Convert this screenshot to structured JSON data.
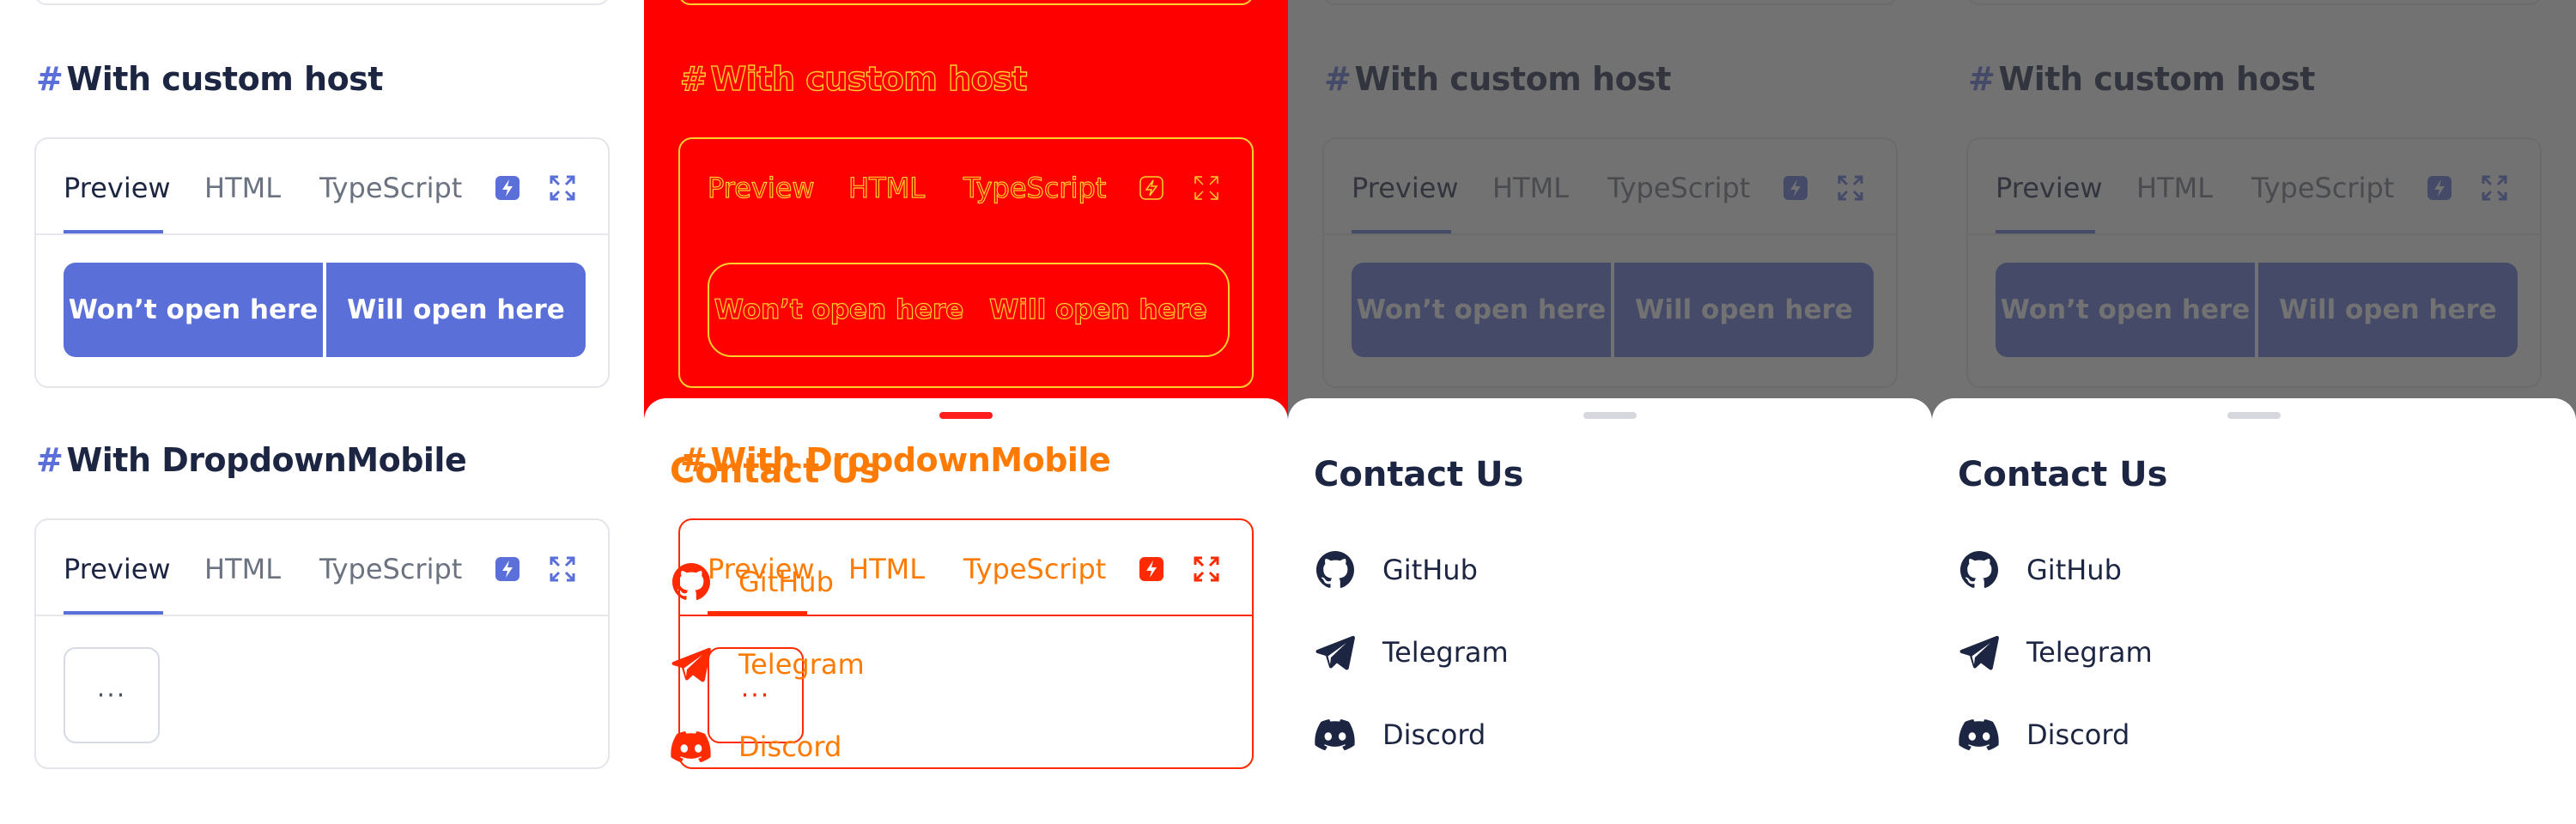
{
  "sections": {
    "custom_host_title": "With custom host",
    "dropdown_title": "With DropdownMobile",
    "hash": "#"
  },
  "tabs": {
    "preview": "Preview",
    "html": "HTML",
    "typescript": "TypeScript"
  },
  "buttons": {
    "wont_open": "Won’t open here",
    "will_open": "Will open here",
    "more": "···"
  },
  "sheet": {
    "title": "Contact Us",
    "items": [
      {
        "label": "GitHub",
        "icon": "github-icon"
      },
      {
        "label": "Telegram",
        "icon": "telegram-icon"
      },
      {
        "label": "Discord",
        "icon": "discord-icon"
      }
    ]
  },
  "colors": {
    "accent": "#5a6fd8",
    "text": "#1c2541",
    "debug_red": "#ff0000",
    "debug_yellow": "#ffcf2e",
    "debug_orange": "#ff7a00"
  }
}
